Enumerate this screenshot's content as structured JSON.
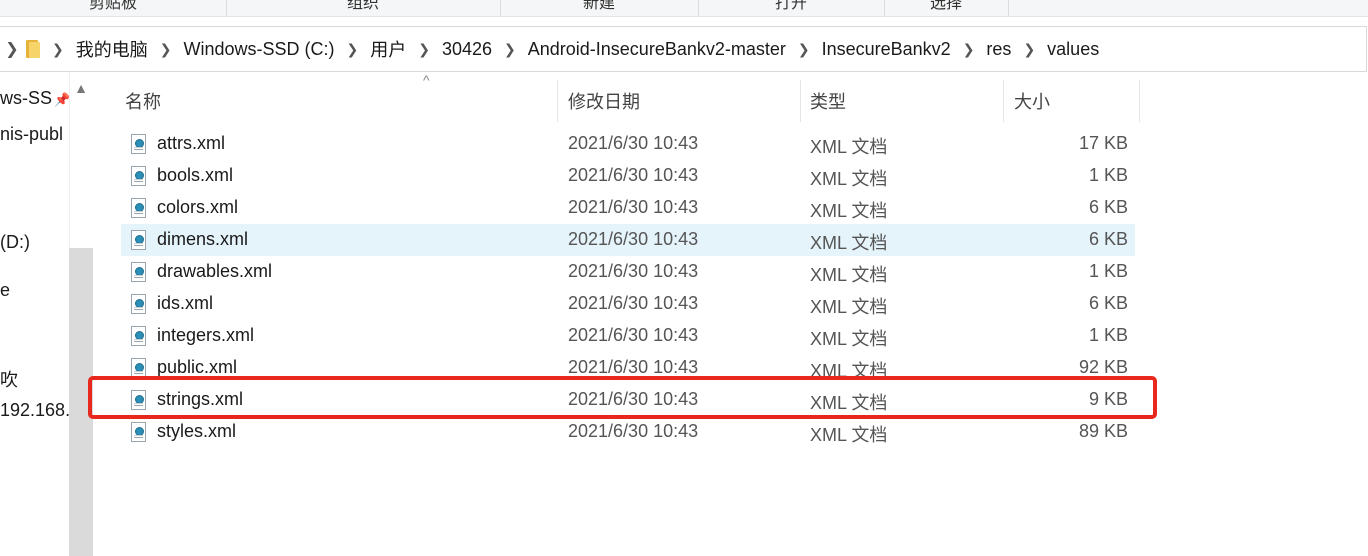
{
  "ribbon": {
    "groups": [
      "剪贴板",
      "组织",
      "新建",
      "打开",
      "选择"
    ]
  },
  "address": {
    "crumbs": [
      "我的电脑",
      "Windows-SSD (C:)",
      "用户",
      "30426",
      "Android-InsecureBankv2-master",
      "InsecureBankv2",
      "res",
      "values"
    ]
  },
  "nav": {
    "items": [
      "ws-SS",
      "nis-publ",
      "(D:)",
      "e",
      "吹",
      "192.168."
    ]
  },
  "columns": {
    "name": "名称",
    "date": "修改日期",
    "type": "类型",
    "size": "大小"
  },
  "files": [
    {
      "name": "attrs.xml",
      "date": "2021/6/30 10:43",
      "type": "XML 文档",
      "size": "17 KB"
    },
    {
      "name": "bools.xml",
      "date": "2021/6/30 10:43",
      "type": "XML 文档",
      "size": "1 KB"
    },
    {
      "name": "colors.xml",
      "date": "2021/6/30 10:43",
      "type": "XML 文档",
      "size": "6 KB"
    },
    {
      "name": "dimens.xml",
      "date": "2021/6/30 10:43",
      "type": "XML 文档",
      "size": "6 KB"
    },
    {
      "name": "drawables.xml",
      "date": "2021/6/30 10:43",
      "type": "XML 文档",
      "size": "1 KB"
    },
    {
      "name": "ids.xml",
      "date": "2021/6/30 10:43",
      "type": "XML 文档",
      "size": "6 KB"
    },
    {
      "name": "integers.xml",
      "date": "2021/6/30 10:43",
      "type": "XML 文档",
      "size": "1 KB"
    },
    {
      "name": "public.xml",
      "date": "2021/6/30 10:43",
      "type": "XML 文档",
      "size": "92 KB"
    },
    {
      "name": "strings.xml",
      "date": "2021/6/30 10:43",
      "type": "XML 文档",
      "size": "9 KB"
    },
    {
      "name": "styles.xml",
      "date": "2021/6/30 10:43",
      "type": "XML 文档",
      "size": "89 KB"
    }
  ],
  "colors": {
    "highlight_box": "#e8281d",
    "hover_row": "#e5f3fb",
    "folder": "#f7d46a"
  }
}
